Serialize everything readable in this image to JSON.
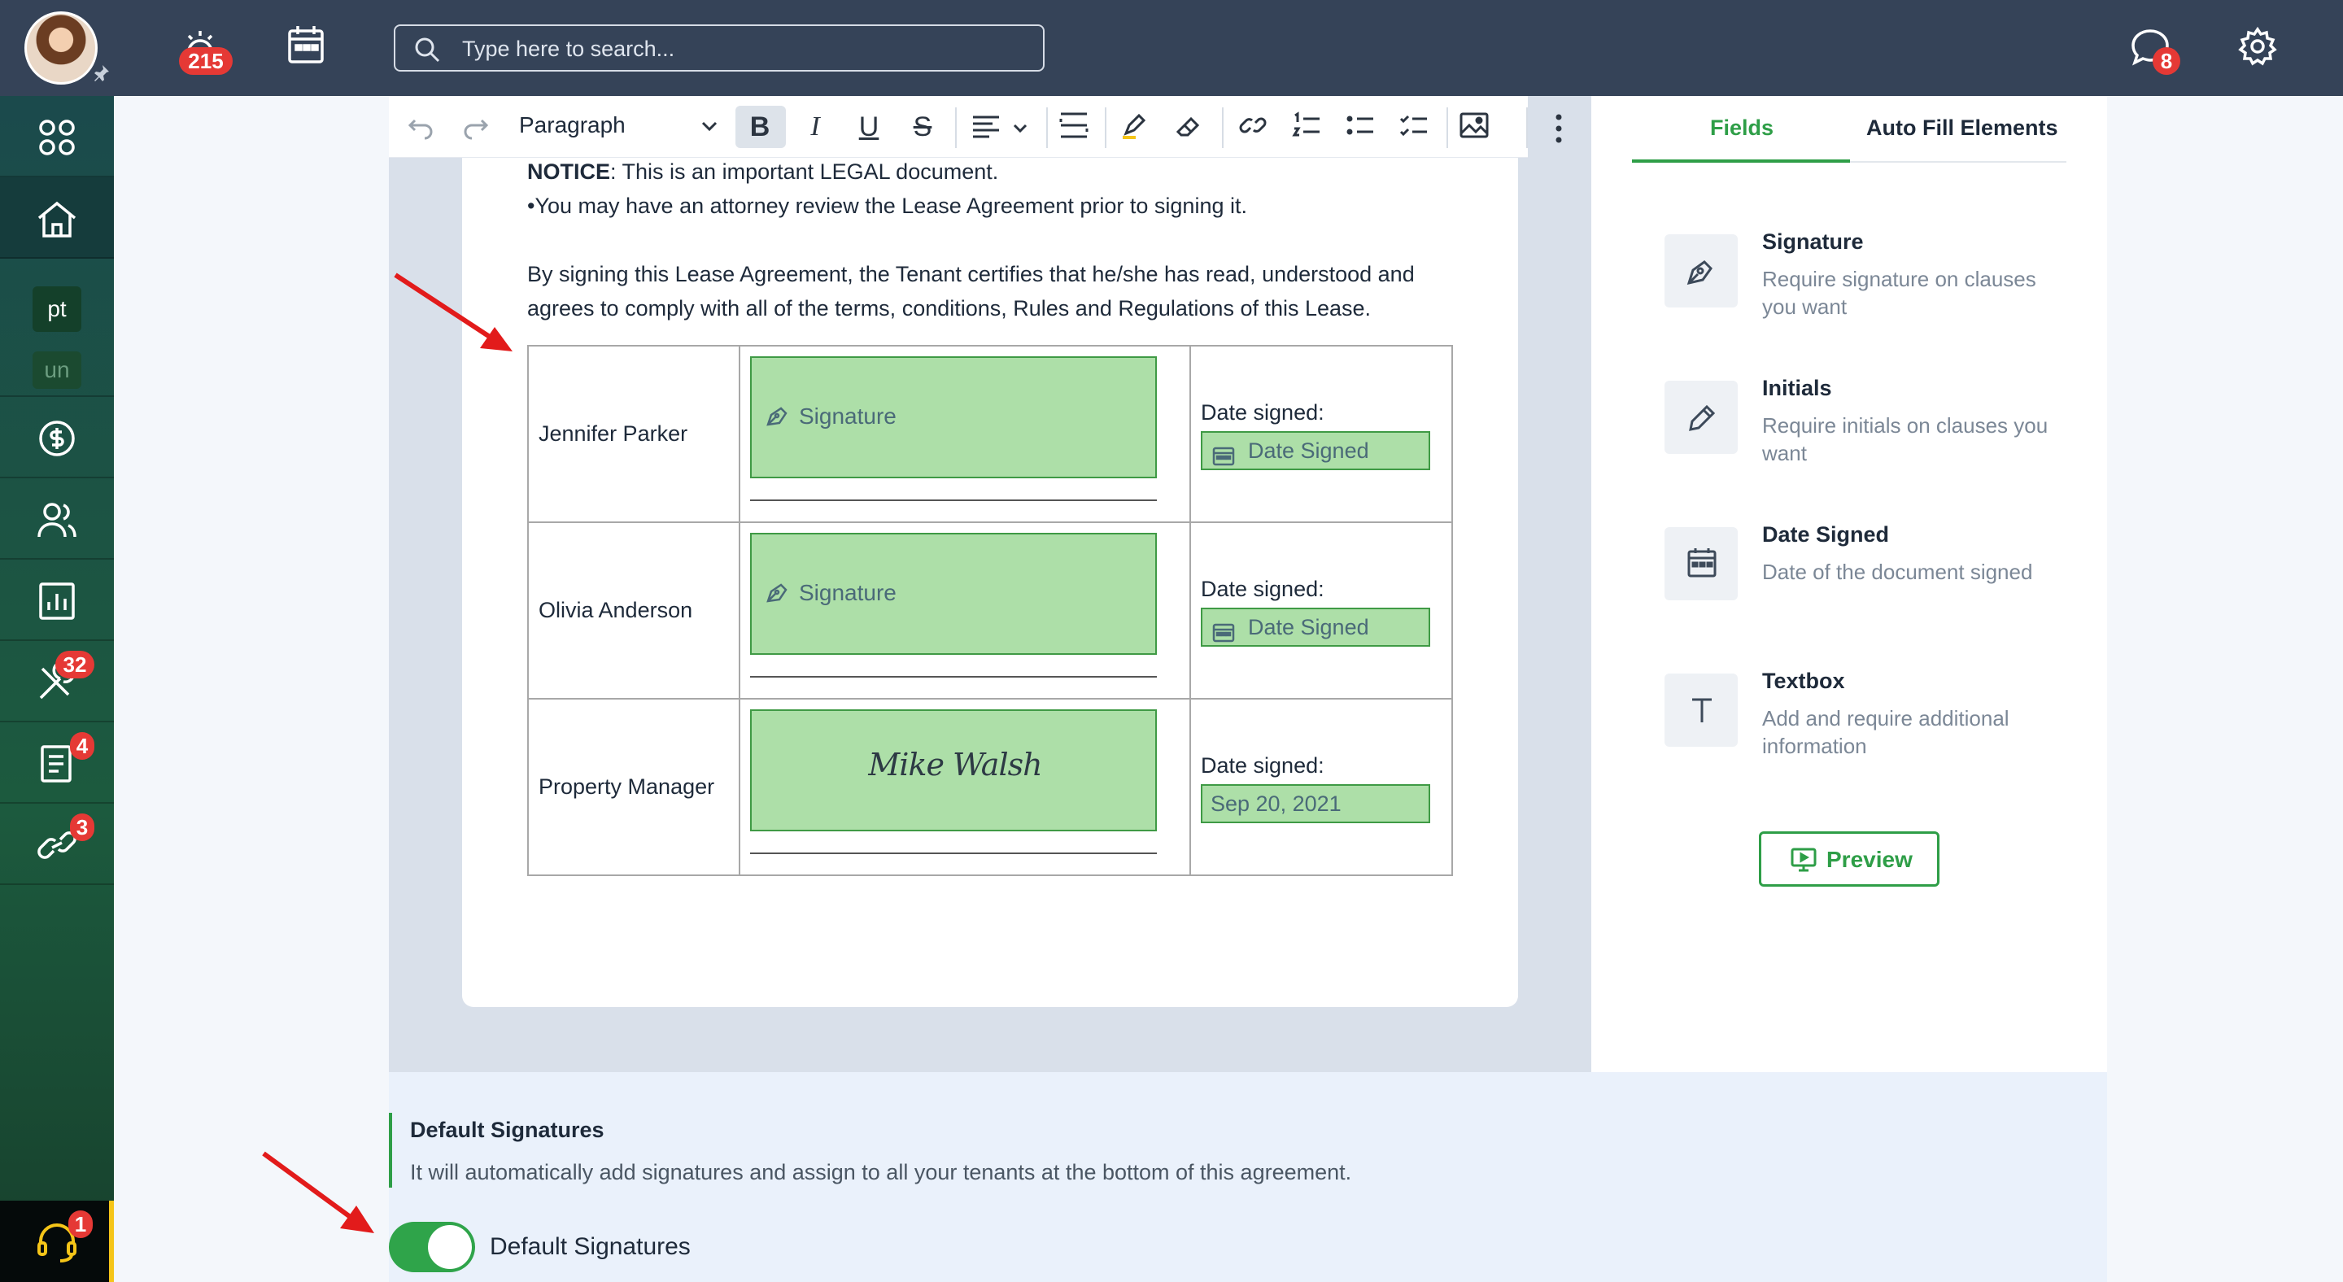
{
  "topbar": {
    "notifications_badge": "215",
    "search_placeholder": "Type here to search...",
    "chat_badge": "8"
  },
  "sidebar": {
    "items": [
      {
        "icon": "apps-grid-icon"
      },
      {
        "icon": "home-icon"
      },
      {
        "label": "pt"
      },
      {
        "label": "un"
      },
      {
        "icon": "dollar-circle-icon"
      },
      {
        "icon": "people-icon"
      },
      {
        "icon": "report-chart-icon"
      },
      {
        "icon": "tools-icon",
        "badge": "32"
      },
      {
        "icon": "document-icon",
        "badge": "4"
      },
      {
        "icon": "link-icon",
        "badge": "3"
      }
    ],
    "support_badge": "1"
  },
  "toolbar": {
    "paragraph_label": "Paragraph"
  },
  "document": {
    "notice_bold": "NOTICE",
    "notice_rest": ": This is an important LEGAL document.",
    "bullet": "•You may have an attorney review the Lease Agreement prior to signing it.",
    "para_line1": "By signing this Lease Agreement, the Tenant certifies that he/she has read, understood and",
    "para_line2": "agrees to comply with all of the terms, conditions, Rules and Regulations of this Lease.",
    "rows": [
      {
        "name": "Jennifer Parker",
        "signature": "Signature",
        "date_label": "Date signed:",
        "date_value": "Date Signed"
      },
      {
        "name": "Olivia Anderson",
        "signature": "Signature",
        "date_label": "Date signed:",
        "date_value": "Date Signed"
      },
      {
        "name": "Property Manager",
        "signature": "Mike Walsh",
        "date_label": "Date signed:",
        "date_value": "Sep 20, 2021"
      }
    ]
  },
  "right_panel": {
    "tabs": [
      {
        "label": "Fields"
      },
      {
        "label": "Auto Fill Elements"
      }
    ],
    "fields": [
      {
        "title": "Signature",
        "desc": "Require signature on clauses you want",
        "icon": "pen-nib-icon"
      },
      {
        "title": "Initials",
        "desc": "Require initials on clauses you want",
        "icon": "pencil-icon"
      },
      {
        "title": "Date Signed",
        "desc": "Date of the document signed",
        "icon": "calendar-icon"
      },
      {
        "title": "Textbox",
        "desc": "Add and require additional information",
        "icon": "text-t-icon"
      }
    ],
    "preview_label": "Preview"
  },
  "default_signatures": {
    "title": "Default Signatures",
    "desc": "It will automatically add signatures and assign to all your tenants at the bottom of this agreement.",
    "toggle_label": "Default Signatures",
    "toggle_on": true
  },
  "colors": {
    "accent": "#2e9e47",
    "topbar": "#354358",
    "sig_fill": "#addfa8",
    "badge": "#e53935"
  }
}
